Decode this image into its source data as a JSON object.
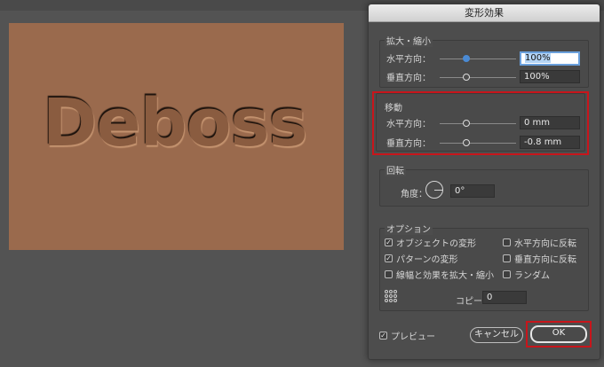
{
  "artboard": {
    "text": "Deboss",
    "color": "#9a6a4d"
  },
  "dialog": {
    "title": "変形効果",
    "scale": {
      "heading": "拡大・縮小",
      "horizontal_label": "水平方向：",
      "horizontal_value": "100%",
      "vertical_label": "垂直方向：",
      "vertical_value": "100%"
    },
    "move": {
      "heading": "移動",
      "horizontal_label": "水平方向：",
      "horizontal_value": "0 mm",
      "vertical_label": "垂直方向：",
      "vertical_value": "-0.8 mm"
    },
    "rotate": {
      "heading": "回転",
      "angle_label": "角度：",
      "angle_value": "0°"
    },
    "options": {
      "heading": "オプション",
      "transform_objects": {
        "label": "オブジェクトの変形",
        "checked": true
      },
      "transform_patterns": {
        "label": "パターンの変形",
        "checked": true
      },
      "scale_strokes": {
        "label": "線幅と効果を拡大・縮小",
        "checked": false
      },
      "reflect_x": {
        "label": "水平方向に反転",
        "checked": false
      },
      "reflect_y": {
        "label": "垂直方向に反転",
        "checked": false
      },
      "random": {
        "label": "ランダム",
        "checked": false
      },
      "copies_label": "コピー",
      "copies_value": "0"
    },
    "preview": {
      "label": "プレビュー",
      "checked": true
    },
    "cancel_label": "キャンセル",
    "ok_label": "OK",
    "highlight_color": "#c8151b"
  }
}
